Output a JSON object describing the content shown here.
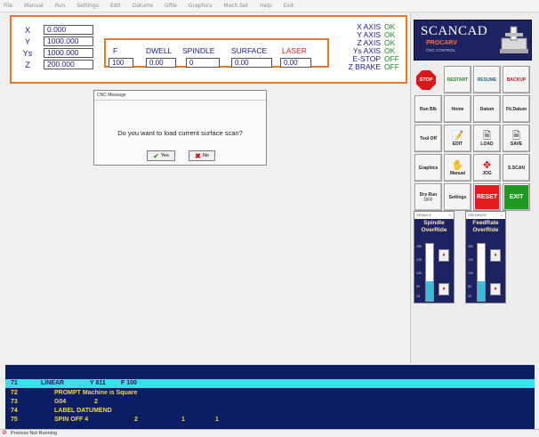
{
  "menu": [
    "File",
    "Manual",
    "Run",
    "Settings",
    "Edit",
    "Datums",
    "Gfile",
    "Graphics",
    "Mach.Set",
    "Help",
    "Exit"
  ],
  "axes": [
    {
      "label": "X",
      "value": "0.000"
    },
    {
      "label": "Y",
      "value": "1000.000"
    },
    {
      "label": "Ys",
      "value": "1000.000"
    },
    {
      "label": "Z",
      "value": "200.000"
    }
  ],
  "params": {
    "f_label": "F",
    "f_value": "100",
    "dwell_label": "DWELL",
    "dwell_value": "0.00",
    "spindle_label": "SPINDLE",
    "spindle_value": "0",
    "surface_label": "SURFACE",
    "surface_value": "0.00",
    "laser_label": "LASER",
    "laser_value": "0.00"
  },
  "status": [
    {
      "label": "X AXIS",
      "value": "OK"
    },
    {
      "label": "Y AXIS",
      "value": "OK"
    },
    {
      "label": "Z AXIS",
      "value": "OK"
    },
    {
      "label": "Ys AXIS",
      "value": "OK"
    },
    {
      "label": "E-STOP",
      "value": "OFF"
    },
    {
      "label": "Z BRAKE",
      "value": "OFF"
    }
  ],
  "logo": {
    "title": "SCANCAD",
    "sub1": "PROCARV",
    "sub2": "CNC CONTROL"
  },
  "buttons": {
    "stop": "STOP",
    "restart": "RESTART",
    "resume": "RESUME",
    "backup": "BACKUP",
    "run_blk": "Run Blk",
    "home": "Home",
    "datum": "Datum",
    "fit_datum": "Fit.Datum",
    "tool_off": "Tool Off",
    "edit": "EDIT",
    "load": "LOAD",
    "save": "SAVE",
    "graphics": "Graphics",
    "manual": "Manual",
    "jog": "JOG",
    "sscan": "S.SCAN",
    "dry_run_1": "Dry Run",
    "dry_run_2": "OFF",
    "settings": "Settings",
    "reset": "RESET",
    "exit": "EXIT"
  },
  "gauges": [
    {
      "tab": "SPINDLE",
      "title1": "Spindle",
      "title2": "OverRide",
      "fill_percent": 35,
      "ticks": [
        "150",
        "125",
        "100",
        "50",
        "10"
      ]
    },
    {
      "tab": "FEEDRATE",
      "title1": "FeedRate",
      "title2": "OverRide",
      "fill_percent": 35,
      "ticks": [
        "150",
        "125",
        "100",
        "50",
        "10"
      ]
    }
  ],
  "dialog": {
    "title": "CNC Message",
    "message": "Do you want to load current surface scan?",
    "yes": "Yes",
    "no": "No"
  },
  "gcode": [
    {
      "n": "71",
      "cmd": "LINEAR",
      "a": "Y 811",
      "b": "F 100",
      "c": "",
      "d": "",
      "highlight": true
    },
    {
      "n": "72",
      "cmd": "PROMPT Machine is Square",
      "a": "",
      "b": "",
      "c": "",
      "d": "",
      "highlight": false
    },
    {
      "n": "73",
      "cmd": "G04",
      "a": "2",
      "b": "",
      "c": "",
      "d": "",
      "highlight": false
    },
    {
      "n": "74",
      "cmd": "LABEL DATUMEND",
      "a": "",
      "b": "",
      "c": "",
      "d": "",
      "highlight": false
    },
    {
      "n": "75",
      "cmd": "SPIN OFF 4",
      "a": "2",
      "b": "1",
      "c": "1",
      "d": "",
      "highlight": false
    }
  ],
  "statusbar": "Process Not Running"
}
